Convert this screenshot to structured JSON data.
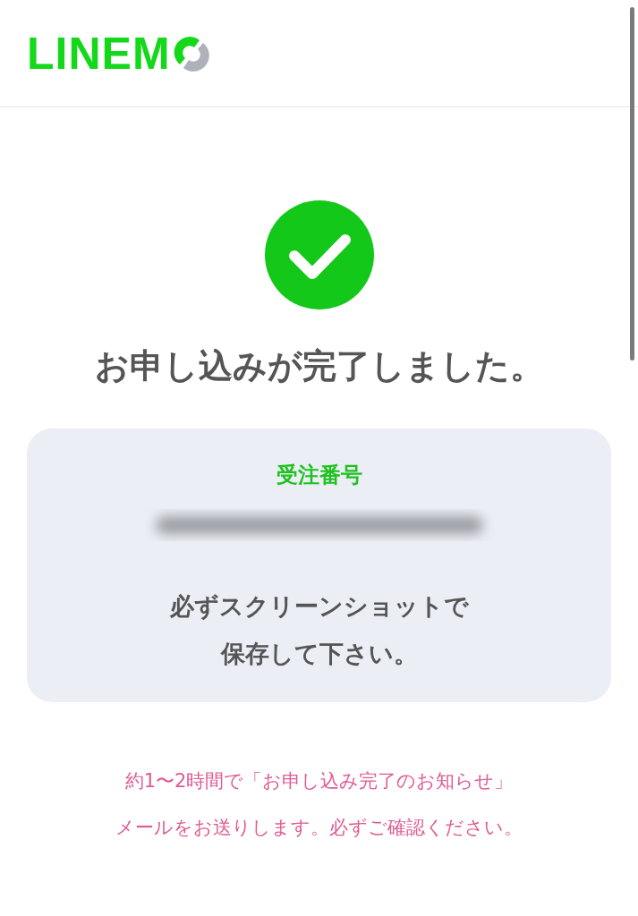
{
  "header": {
    "logo_text": "LINEM"
  },
  "status": {
    "title": "お申し込みが完了しました。"
  },
  "order_card": {
    "label": "受注番号",
    "note_lines": [
      "必ずスクリーンショットで",
      "保存して下さい。"
    ]
  },
  "notice_lines": [
    "約1〜2時間で「お申し込み完了のお知らせ」",
    "メールをお送りします。必ずご確認ください。"
  ]
}
